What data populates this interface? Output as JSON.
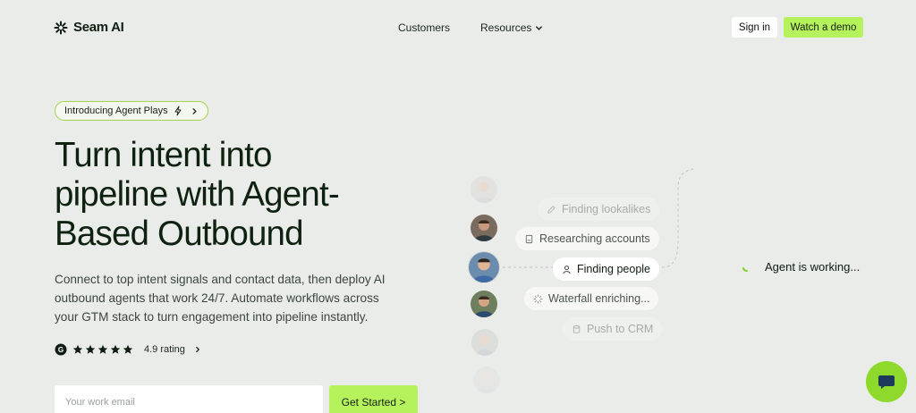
{
  "brand": {
    "name": "Seam AI",
    "accent": "#b6f25c"
  },
  "nav": {
    "customers": "Customers",
    "resources": "Resources",
    "signin": "Sign in",
    "demo": "Watch a demo"
  },
  "hero": {
    "pill": "Introducing Agent Plays",
    "headline": [
      "Turn intent into",
      "pipeline with Agent-",
      "Based Outbound"
    ],
    "subtext": [
      "Connect to top intent signals and contact data, then deploy AI",
      "outbound agents that work 24/7. Automate workflows across",
      "your GTM stack to turn engagement into pipeline instantly."
    ],
    "rating": "4.9 rating",
    "stars": 5,
    "email_placeholder": "Your work email",
    "cta": "Get Started >"
  },
  "agent": {
    "steps": [
      {
        "label": "Finding lookalikes",
        "icon": "pencil-icon",
        "state": "faint"
      },
      {
        "label": "Researching accounts",
        "icon": "document-icon",
        "state": "mid"
      },
      {
        "label": "Finding people",
        "icon": "person-icon",
        "state": "active"
      },
      {
        "label": "Waterfall enriching...",
        "icon": "loading-icon",
        "state": "mid"
      },
      {
        "label": "Push to CRM",
        "icon": "database-icon",
        "state": "faint"
      }
    ],
    "status": "Agent is working..."
  }
}
